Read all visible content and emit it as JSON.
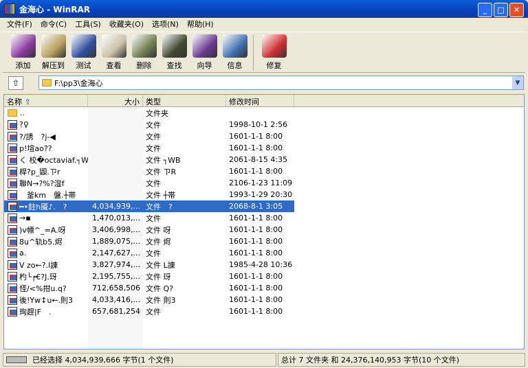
{
  "window": {
    "title": "金海心 - WinRAR",
    "min": "_",
    "max": "□",
    "close": "✕"
  },
  "menu": [
    "文件(F)",
    "命令(C)",
    "工具(S)",
    "收藏夹(O)",
    "选项(N)",
    "帮助(H)"
  ],
  "toolbar": [
    {
      "label": "添加",
      "icon": "add-icon",
      "color": "#8a3aa0"
    },
    {
      "label": "解压到",
      "icon": "extract-icon",
      "color": "#b8a060"
    },
    {
      "label": "测试",
      "icon": "test-icon",
      "color": "#3050a0"
    },
    {
      "label": "查看",
      "icon": "view-icon",
      "color": "#c8c0a8"
    },
    {
      "label": "删除",
      "icon": "delete-icon",
      "color": "#708050"
    },
    {
      "label": "查找",
      "icon": "find-icon",
      "color": "#404830"
    },
    {
      "label": "向导",
      "icon": "wizard-icon",
      "color": "#6a3a90"
    },
    {
      "label": "信息",
      "icon": "info-icon",
      "color": "#4070b0"
    },
    {
      "label": "修复",
      "icon": "repair-icon",
      "color": "#d03030"
    }
  ],
  "address": {
    "path": "F:\\pp3\\金海心"
  },
  "columns": {
    "name": "名称",
    "size": "大小",
    "type": "类型",
    "modified": "修改时间"
  },
  "files": [
    {
      "name": "..",
      "size": "",
      "type": "文件夹",
      "modified": "",
      "folder": true
    },
    {
      "name": "?♀",
      "size": "",
      "type": "文件",
      "modified": "1998-10-1 2:56"
    },
    {
      "name": "?/誘　?j-◀",
      "size": "",
      "type": "文件",
      "modified": "1601-1-1 8:00"
    },
    {
      "name": "p!塇ao??",
      "size": "",
      "type": "文件",
      "modified": "1601-1-1 8:00"
    },
    {
      "name": "く 校�octaviaf.┐WB",
      "size": "",
      "type": "文件 ┐WB",
      "modified": "2061-8-15 4:35"
    },
    {
      "name": "桿?p_鼰.ㄗr",
      "size": "",
      "type": "文件 ㄗR",
      "modified": "1601-1-1 8:00"
    },
    {
      "name": "聯N→?%?湿f",
      "size": "",
      "type": "文件",
      "modified": "2106-1-23 11:09"
    },
    {
      "name": "　釜km　盤.┼帯",
      "size": "",
      "type": "文件 ┼帯",
      "modified": "1993-1-29 20:30"
    },
    {
      "name": "━•鉒h魇♪.　?",
      "size": "4,034,939,...",
      "type": "文件　?",
      "modified": "2068-8-1 3:05",
      "selected": true
    },
    {
      "name": "→▪",
      "size": "1,470,013,...",
      "type": "文件",
      "modified": "1601-1-1 8:00"
    },
    {
      "name": ")v幖^_=A.呀",
      "size": "3,406,998,...",
      "type": "文件 呀",
      "modified": "1601-1-1 8:00"
    },
    {
      "name": "8u^轨b5.烬",
      "size": "1,889,075,...",
      "type": "文件 烬",
      "modified": "1601-1-1 8:00"
    },
    {
      "name": "a.",
      "size": "2,147,627,...",
      "type": "文件",
      "modified": "1601-1-1 8:00"
    },
    {
      "name": "V zo←?.l諌",
      "size": "3,827,974,...",
      "type": "文件 L諌",
      "modified": "1985-4-28 10:36"
    },
    {
      "name": "杓└╒€?J.玡",
      "size": "2,195,755,...",
      "type": "文件 玡",
      "modified": "1601-1-1 8:00"
    },
    {
      "name": "怪/<%拑u.q?",
      "size": "712,658,506",
      "type": "文件 Q?",
      "modified": "1601-1-1 8:00"
    },
    {
      "name": "後!Yw↕u←.則3",
      "size": "4,033,416,...",
      "type": "文件 則3",
      "modified": "1601-1-1 8:00"
    },
    {
      "name": "珣趕|F　.",
      "size": "657,681,254",
      "type": "文件",
      "modified": "1601-1-1 8:00"
    }
  ],
  "status": {
    "left": "已经选择 4,034,939,666 字节(1 个文件)",
    "right": "总计 7 文件夹 和 24,376,140,953 字节(10 个文件)"
  }
}
